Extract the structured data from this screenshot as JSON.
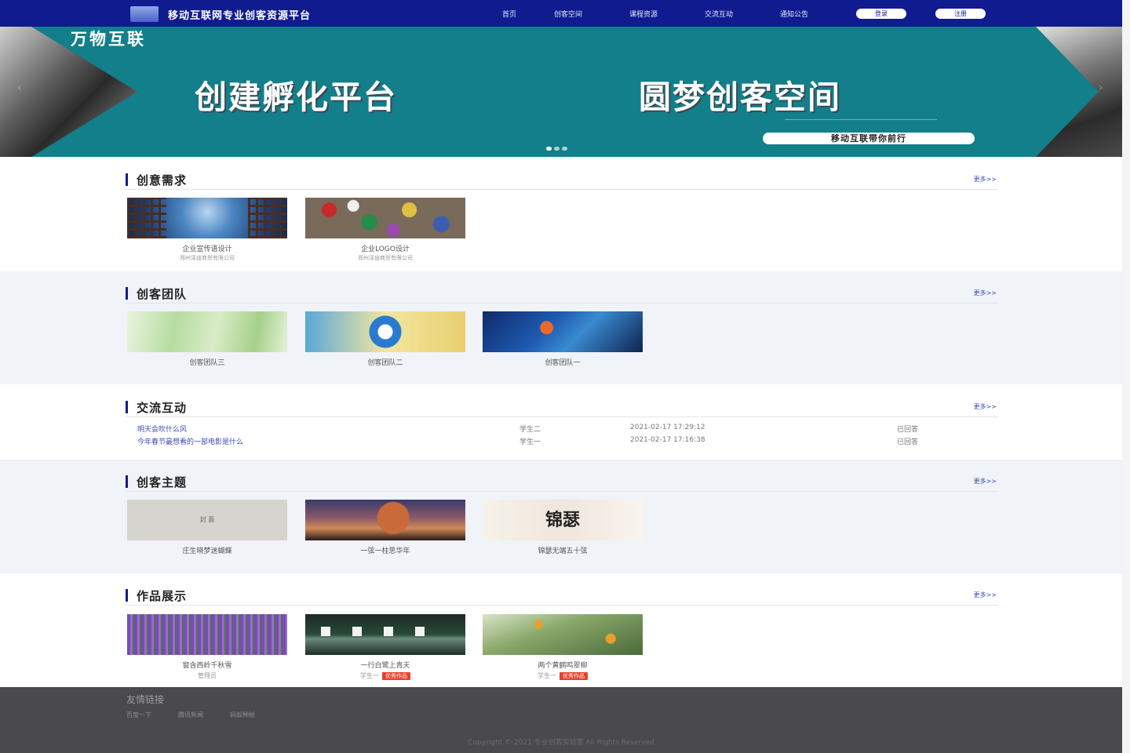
{
  "nav": {
    "site_title": "移动互联网专业创客资源平台",
    "links": [
      "首页",
      "创客空间",
      "课程资源",
      "交流互动",
      "通知公告"
    ],
    "login_label": "登录",
    "register_label": "注册"
  },
  "banner": {
    "kicker": "万物互联",
    "headline_left": "创建孵化平台",
    "headline_right": "圆梦创客空间",
    "pill": "移动互联带你前行",
    "prev_arrow": "‹",
    "next_arrow": "›"
  },
  "sections": {
    "needs": {
      "title": "创意需求",
      "more": "更多>>",
      "items": [
        {
          "caption": "企业宣传语设计",
          "company": "郑州泽迪商贸有限公司"
        },
        {
          "caption": "企业LOGO设计",
          "company": "郑州泽迪商贸有限公司"
        }
      ]
    },
    "teams": {
      "title": "创客团队",
      "more": "更多>>",
      "items": [
        {
          "caption": "创客团队三"
        },
        {
          "caption": "创客团队二"
        },
        {
          "caption": "创客团队一"
        }
      ]
    },
    "discussion": {
      "title": "交流互动",
      "more": "更多>>",
      "rows": [
        {
          "topic": "明天会吹什么风",
          "user": "学生二",
          "time": "2021-02-17 17:29:12",
          "status": "已回答"
        },
        {
          "topic": "今年春节最想看的一部电影是什么",
          "user": "学生一",
          "time": "2021-02-17 17:16:38",
          "status": "已回答"
        }
      ]
    },
    "themes": {
      "title": "创客主题",
      "more": "更多>>",
      "items": [
        {
          "caption": "庄生晓梦迷蝴蝶",
          "thumb_text": "封 面"
        },
        {
          "caption": "一弦一柱思华年"
        },
        {
          "caption": "锦瑟无端五十弦",
          "thumb_text": "锦瑟"
        }
      ]
    },
    "works": {
      "title": "作品展示",
      "more": "更多>>",
      "items": [
        {
          "caption": "窗含西岭千秋雪",
          "author": "管理员",
          "badge": ""
        },
        {
          "caption": "一行白鹭上青天",
          "author": "学生一",
          "badge": "优秀作品"
        },
        {
          "caption": "两个黄鹂鸣翠柳",
          "author": "学生一",
          "badge": "优秀作品"
        }
      ]
    }
  },
  "footer": {
    "title": "友情链接",
    "links": [
      "百度一下",
      "腾讯新闻",
      "蚂蚁种树"
    ],
    "copyright": "Copyright © 2021 专业创客实验室 All Rights Reserved"
  },
  "colors": {
    "nav_bg": "#0f1b8f",
    "banner_bg": "#127f8a",
    "badge": "#e8402a",
    "footer_bg": "#4a4a4c"
  }
}
